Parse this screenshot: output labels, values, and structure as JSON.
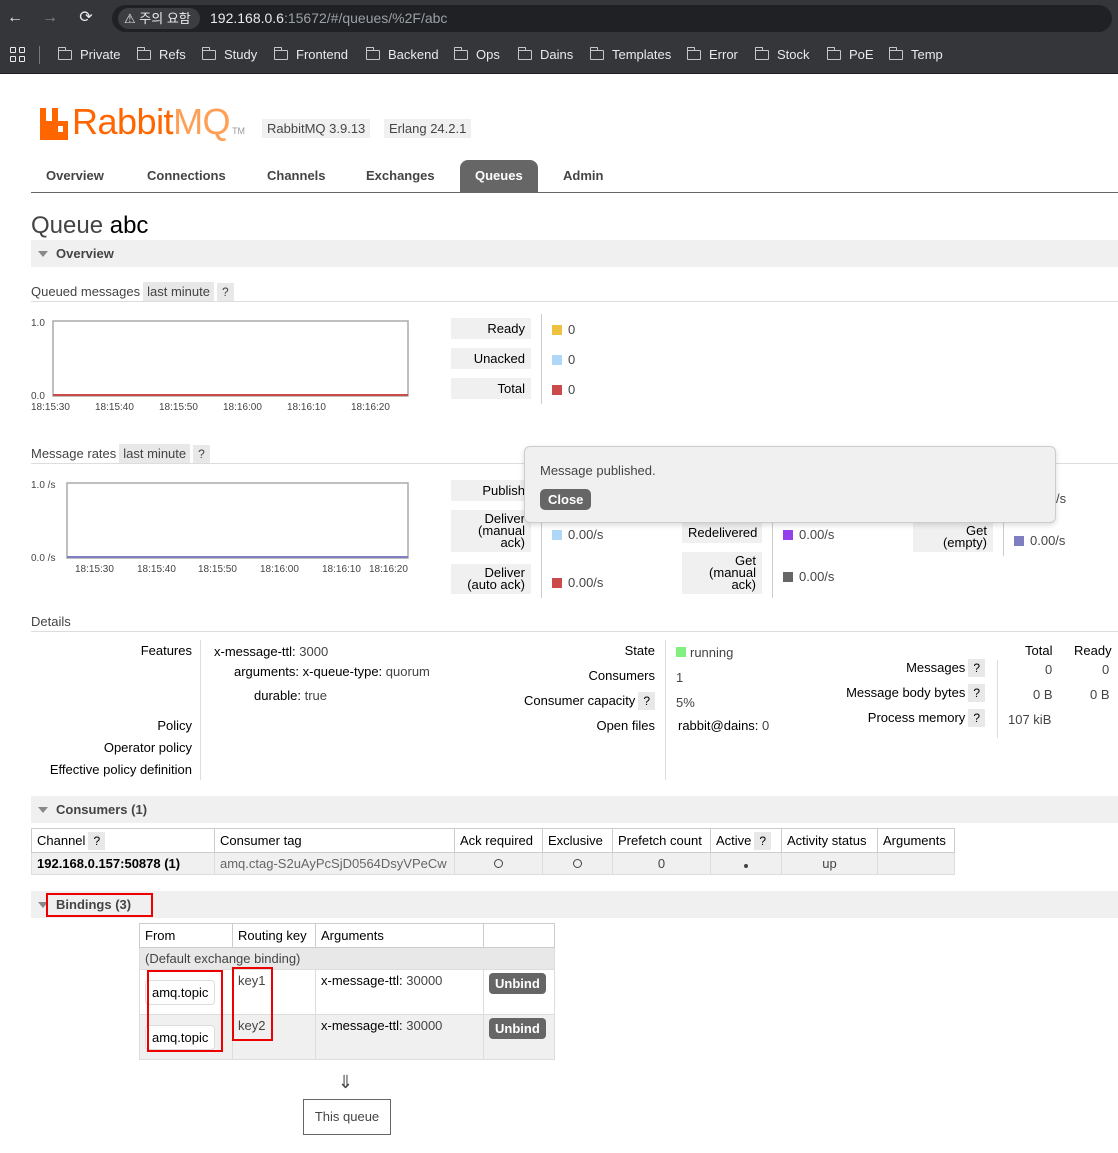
{
  "browser": {
    "warning": "주의 요함",
    "url_host": "192.168.0.6",
    "url_rest": ":15672/#/queues/%2F/abc",
    "bookmarks": [
      "Private",
      "Refs",
      "Study",
      "Frontend",
      "Backend",
      "Ops",
      "Dains",
      "Templates",
      "Error",
      "Stock",
      "PoE",
      "Temp"
    ]
  },
  "header": {
    "logo_main": "Rabbit",
    "logo_mq": "MQ",
    "logo_tm": "TM",
    "rabbit_version": "RabbitMQ 3.9.13",
    "erlang_version": "Erlang 24.2.1"
  },
  "tabs": [
    "Overview",
    "Connections",
    "Channels",
    "Exchanges",
    "Queues",
    "Admin"
  ],
  "active_tab": "Queues",
  "page": {
    "title_prefix": "Queue",
    "title_name": "abc"
  },
  "overview": {
    "section_label": "Overview",
    "queued": {
      "label": "Queued messages",
      "range": "last minute",
      "help": "?",
      "y_ticks": [
        "1.0",
        "0.0"
      ],
      "x_ticks": [
        "18:15:30",
        "18:15:40",
        "18:15:50",
        "18:16:00",
        "18:16:10",
        "18:16:20"
      ],
      "legend": [
        {
          "label": "Ready",
          "value": "0",
          "color": "#edc240"
        },
        {
          "label": "Unacked",
          "value": "0",
          "color": "#afd8f8"
        },
        {
          "label": "Total",
          "value": "0",
          "color": "#cb4b4b"
        }
      ]
    },
    "rates": {
      "label": "Message rates",
      "range": "last minute",
      "help": "?",
      "y_ticks": [
        "1.0 /s",
        "0.0 /s"
      ],
      "x_ticks": [
        "18:15:30",
        "18:15:40",
        "18:15:50",
        "18:16:00",
        "18:16:10",
        "18:16:20"
      ],
      "publish_label": "Publish",
      "deliver_manual_label": [
        "Deliver",
        "(manual",
        "ack)"
      ],
      "deliver_manual_value": "0.00/s",
      "deliver_auto_label": [
        "Deliver",
        "(auto ack)"
      ],
      "deliver_auto_value": "0.00/s",
      "redelivered_label": "Redelivered",
      "redelivered_value": "0.00/s",
      "get_manual_label": [
        "Get",
        "(manual",
        "ack)"
      ],
      "get_manual_value": "0.00/s",
      "get_empty_label": [
        "Get",
        "(empty)"
      ],
      "get_empty_value": "0.00/s",
      "hidden_rate_suffix": "/s",
      "colors": {
        "deliver_manual": "#afd8f8",
        "deliver_auto": "#cb4b4b",
        "redelivered": "#9440ed",
        "get_manual": "#666666",
        "get_empty": "#7e7ec0"
      }
    }
  },
  "popup": {
    "message": "Message published.",
    "close_label": "Close"
  },
  "details": {
    "label": "Details",
    "features_label": "Features",
    "features": [
      {
        "key": "x-message-ttl:",
        "value": "3000"
      },
      {
        "key": "arguments:",
        "value_key": "x-queue-type:",
        "value": "quorum"
      },
      {
        "key": "durable:",
        "value": "true"
      }
    ],
    "policy_label": "Policy",
    "operator_policy_label": "Operator policy",
    "effective_policy_label": "Effective policy definition",
    "state_label": "State",
    "state_value": "running",
    "consumers_label": "Consumers",
    "consumers_value": "1",
    "capacity_label": "Consumer capacity",
    "capacity_value": "5%",
    "open_files_label": "Open files",
    "open_files_key": "rabbit@dains:",
    "open_files_value": "0",
    "stats_headers": [
      "Total",
      "Ready"
    ],
    "messages_label": "Messages",
    "messages_total": "0",
    "messages_ready": "0",
    "body_bytes_label": "Message body bytes",
    "body_bytes_total": "0 B",
    "body_bytes_ready": "0 B",
    "process_memory_label": "Process memory",
    "process_memory_value": "107 kiB"
  },
  "consumers": {
    "section_label": "Consumers (1)",
    "headers": [
      "Channel",
      "Consumer tag",
      "Ack required",
      "Exclusive",
      "Prefetch count",
      "Active",
      "Activity status",
      "Arguments"
    ],
    "row": {
      "channel": "192.168.0.157:50878 (1)",
      "tag": "amq.ctag-S2uAyPcSjD0564DsyVPeCw",
      "prefetch": "0",
      "status": "up"
    }
  },
  "bindings": {
    "section_label": "Bindings (3)",
    "headers": [
      "From",
      "Routing key",
      "Arguments"
    ],
    "default_binding": "(Default exchange binding)",
    "rows": [
      {
        "from": "amq.topic",
        "key": "key1",
        "arg_key": "x-message-ttl:",
        "arg_value": "30000",
        "action": "Unbind"
      },
      {
        "from": "amq.topic",
        "key": "key2",
        "arg_key": "x-message-ttl:",
        "arg_value": "30000",
        "action": "Unbind"
      }
    ],
    "arrow": "⇓",
    "this_queue": "This queue"
  }
}
